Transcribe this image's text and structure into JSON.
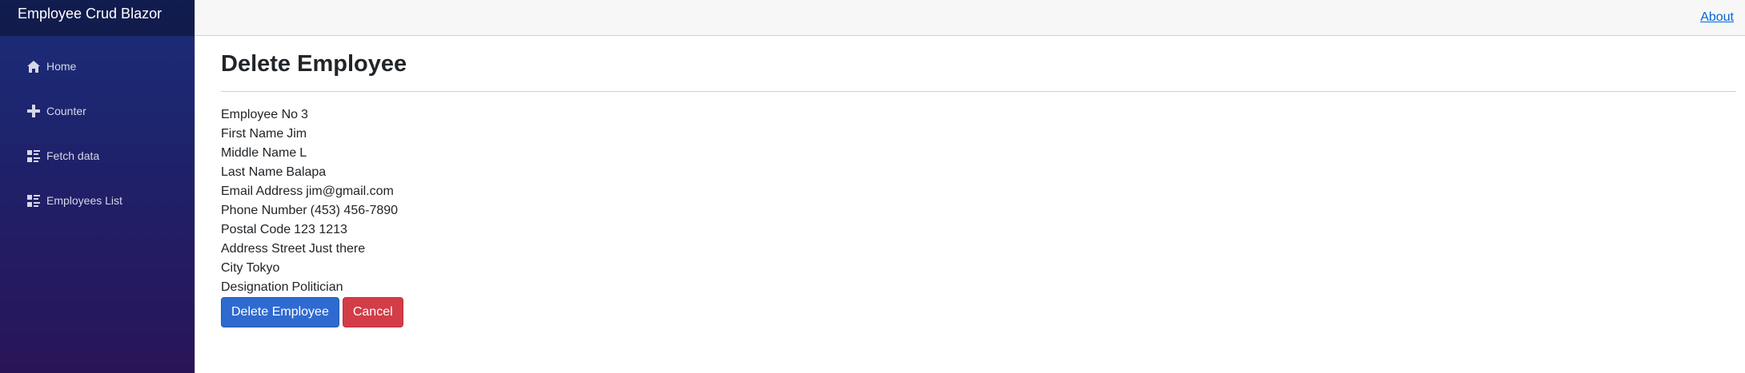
{
  "sidebar": {
    "brand": "Employee Crud Blazor",
    "items": [
      {
        "label": "Home",
        "icon": "home-icon"
      },
      {
        "label": "Counter",
        "icon": "plus-icon"
      },
      {
        "label": "Fetch data",
        "icon": "list-rich-icon"
      },
      {
        "label": "Employees List",
        "icon": "list-rich-icon"
      }
    ]
  },
  "header": {
    "about_label": "About"
  },
  "main": {
    "title": "Delete Employee",
    "fields": [
      {
        "label": "Employee No",
        "value": "3"
      },
      {
        "label": "First Name",
        "value": "Jim"
      },
      {
        "label": "Middle Name",
        "value": "L"
      },
      {
        "label": "Last Name",
        "value": "Balapa"
      },
      {
        "label": "Email Address",
        "value": "jim@gmail.com"
      },
      {
        "label": "Phone Number",
        "value": "(453) 456-7890"
      },
      {
        "label": "Postal Code",
        "value": "123 1213"
      },
      {
        "label": "Address Street",
        "value": "Just there"
      },
      {
        "label": "City",
        "value": "Tokyo"
      },
      {
        "label": "Designation",
        "value": "Politician"
      }
    ],
    "delete_label": "Delete Employee",
    "cancel_label": "Cancel"
  },
  "colors": {
    "sidebar_top": "#1b2d79",
    "sidebar_bottom": "#2a1458",
    "primary": "#2f6ad0",
    "danger": "#d23d47",
    "link": "#0366d6"
  }
}
